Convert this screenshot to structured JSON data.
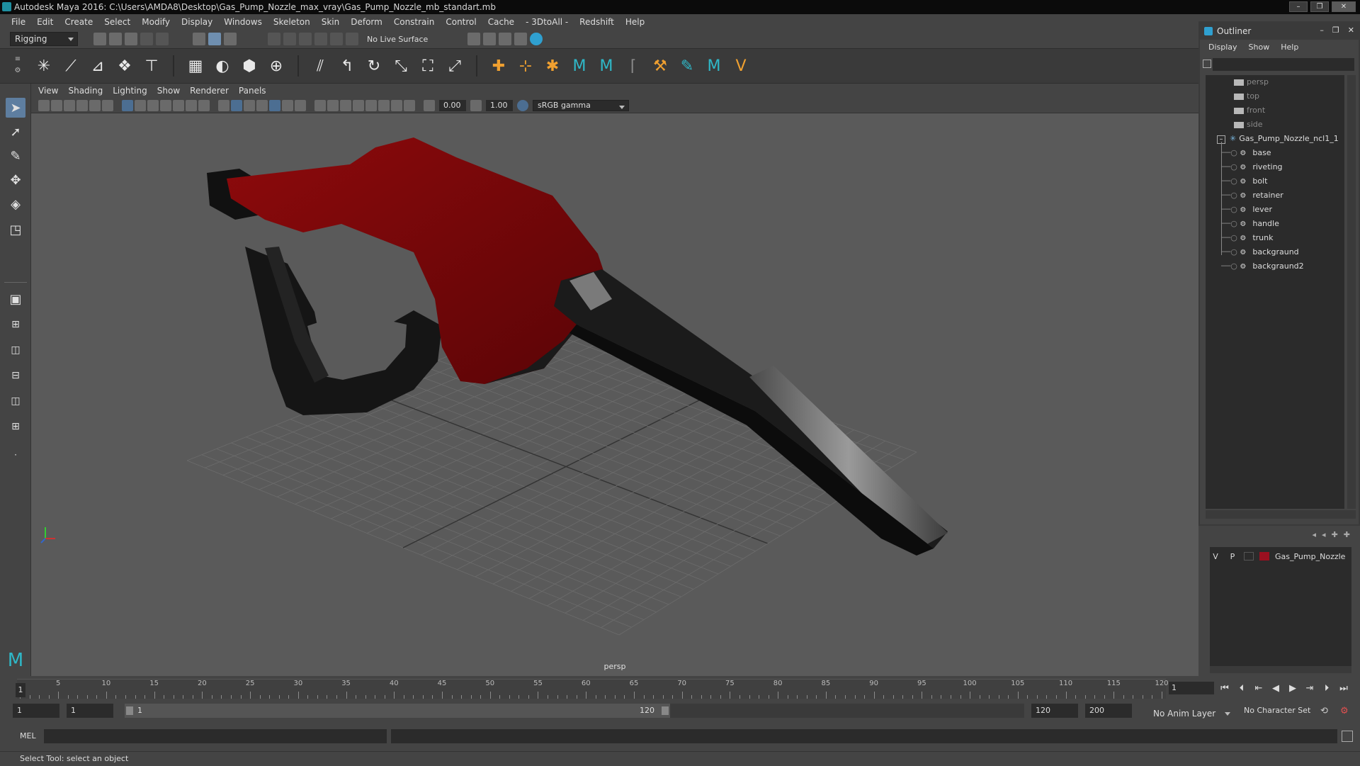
{
  "window": {
    "title": "Autodesk Maya 2016: C:\\Users\\AMDA8\\Desktop\\Gas_Pump_Nozzle_max_vray\\Gas_Pump_Nozzle_mb_standart.mb"
  },
  "menubar": {
    "items": [
      "File",
      "Edit",
      "Create",
      "Select",
      "Modify",
      "Display",
      "Windows",
      "Skeleton",
      "Skin",
      "Deform",
      "Constrain",
      "Control",
      "Cache",
      "- 3DtoAll -",
      "Redshift",
      "Help"
    ]
  },
  "statusline": {
    "mode": "Rigging",
    "live_surface": "No Live Surface"
  },
  "viewport": {
    "menu": [
      "View",
      "Shading",
      "Lighting",
      "Show",
      "Renderer",
      "Panels"
    ],
    "exposure": "0.00",
    "gamma": "1.00",
    "color_space": "sRGB gamma",
    "camera_label": "persp"
  },
  "outliner": {
    "title": "Outliner",
    "menu": [
      "Display",
      "Show",
      "Help"
    ],
    "cameras": [
      "persp",
      "top",
      "front",
      "side"
    ],
    "group": "Gas_Pump_Nozzle_ncl1_1",
    "children": [
      "base",
      "riveting",
      "bolt",
      "retainer",
      "lever",
      "handle",
      "trunk",
      "backgraund",
      "backgraund2"
    ]
  },
  "layers": {
    "v": "V",
    "p": "P",
    "layer_name": "Gas_Pump_Nozzle",
    "layer_color": "#9a1020"
  },
  "timeline": {
    "current_frame": "1",
    "tick_labels": [
      "5",
      "10",
      "15",
      "20",
      "25",
      "30",
      "35",
      "40",
      "45",
      "50",
      "55",
      "60",
      "65",
      "70",
      "75",
      "80",
      "85",
      "90",
      "95",
      "100",
      "105",
      "110",
      "115",
      "120"
    ],
    "frame_field": "1"
  },
  "range": {
    "start": "1",
    "playback_start": "1",
    "slider_start": "1",
    "slider_end": "120",
    "playback_end": "120",
    "end": "200",
    "anim_layer": "No Anim Layer",
    "char_set": "No Character Set"
  },
  "cmdline": {
    "label": "MEL"
  },
  "helpline": {
    "text": "Select Tool: select an object"
  },
  "colors": {
    "nozzle_red": "#7a0608",
    "nozzle_dark": "#141414",
    "grid": "#6a6a6a"
  }
}
